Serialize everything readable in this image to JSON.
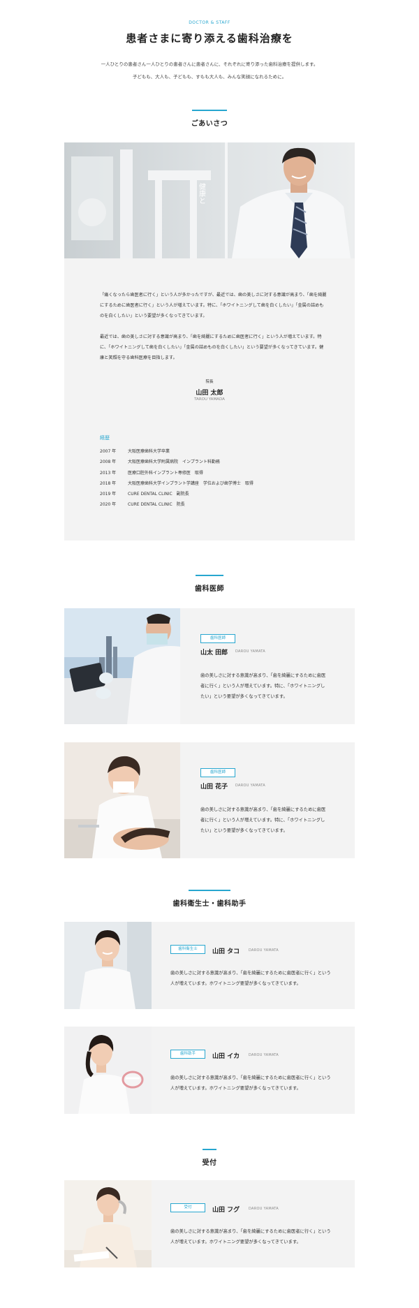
{
  "hero": {
    "eyebrow": "DOCTOR & STAFF",
    "title": "患者さまに寄り添える歯科治療を",
    "lead_line1": "一人ひとりの患者さん一人ひとりの患者さんに患者さんに、それぞれに寄り添った歯科治療を提供します。",
    "lead_line2": "子どもも、大人も、子どもも、すもも大人も、みんな笑顔になれるために。"
  },
  "greeting": {
    "heading": "ごあいさつ",
    "photo_caption": "健康と",
    "paragraph1": "「痛くなったら歯医者に行く」という人が多かったですが、最近では、歯の美しさに対する意識が高まり、「歯を綺麗にするために歯医者に行く」という人が増えています。特に、「ホワイトニングして歯を白くしたい」「金属の詰めものを白くしたい」という要望が多くなってきています。",
    "paragraph2": "最近では、歯の美しさに対する意識が高まり、「歯を綺麗にするために歯医者に行く」という人が増えています。特に、「ホワイトニングして歯を白くしたい」「金属の詰めものを白くしたい」という要望が多くなってきています。健康と笑顔を守る歯科医療を目指します。",
    "role": "院長",
    "name": "山田 太郎",
    "name_en": "TAROU YAMADA",
    "career_heading": "経歴",
    "career": [
      {
        "year": "2007 年",
        "text": "大阪医療歯科大学卒業"
      },
      {
        "year": "2008 年",
        "text": "大阪医療歯科大学附属病院　インプラント科勤務"
      },
      {
        "year": "2013 年",
        "text": "医療口腔外科インプラント専修医　取得"
      },
      {
        "year": "2018 年",
        "text": "大阪医療歯科大学インプラント学講座　学位および歯学博士　取得"
      },
      {
        "year": "2019 年",
        "text": "CURE DENTAL CLINIC　副院長"
      },
      {
        "year": "2020 年",
        "text": "CURE DENTAL CLINIC　院長"
      }
    ]
  },
  "dentists": {
    "heading": "歯科医師",
    "members": [
      {
        "badge": "歯科医師",
        "name": "山太 田郎",
        "name_en": "DAROU YAMATA",
        "desc": "歯の美しさに対する意識が高まり、「歯を綺麗にするために歯医者に行く」という人が増えています。特に、「ホワイトニングしたい」という要望が多くなってきています。"
      },
      {
        "badge": "歯科医師",
        "name": "山田 花子",
        "name_en": "DAROU YAMATA",
        "desc": "歯の美しさに対する意識が高まり、「歯を綺麗にするために歯医者に行く」という人が増えています。特に、「ホワイトニングしたい」という要望が多くなってきています。"
      }
    ]
  },
  "hygienists": {
    "heading": "歯科衛生士・歯科助手",
    "members": [
      {
        "badge": "歯科衛生士",
        "name": "山田 タコ",
        "name_en": "DAROU YAMATA",
        "desc": "歯の美しさに対する意識が高まり、「歯を綺麗にするために歯医者に行く」という人が増えています。ホワイトニング要望が多くなってきています。"
      },
      {
        "badge": "歯科助手",
        "name": "山田 イカ",
        "name_en": "DAROU YAMATA",
        "desc": "歯の美しさに対する意識が高まり、「歯を綺麗にするために歯医者に行く」という人が増えています。ホワイトニング要望が多くなってきています。"
      }
    ]
  },
  "reception": {
    "heading": "受付",
    "members": [
      {
        "badge": "受付",
        "name": "山田 フグ",
        "name_en": "DAROU YAMATA",
        "desc": "歯の美しさに対する意識が高まり、「歯を綺麗にするために歯医者に行く」という人が増えています。ホワイトニング要望が多くなってきています。"
      }
    ]
  },
  "colors": {
    "accent": "#27a6cf",
    "card_bg": "#f3f3f3",
    "text": "#333333"
  }
}
